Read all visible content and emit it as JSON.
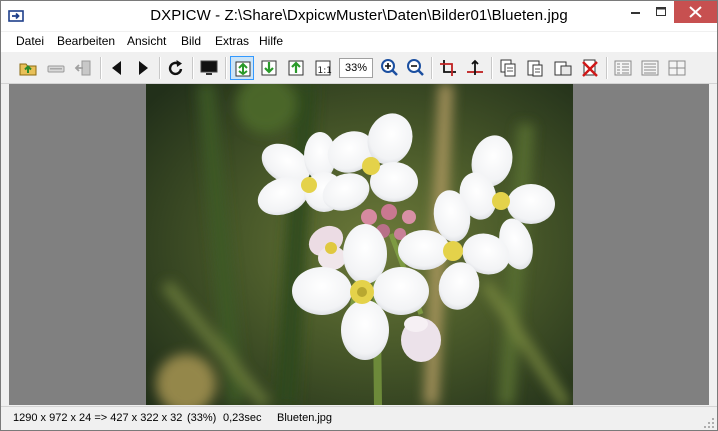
{
  "window": {
    "title": "DXPICW - Z:\\Share\\DxpicwMuster\\Daten\\Bilder01\\Blueten.jpg",
    "icons": {
      "app": "dxpicw-app-icon",
      "minimize": "minimize-icon",
      "maximize": "maximize-icon",
      "close": "close-icon"
    },
    "colors": {
      "close": "#c75050",
      "viewport": "#808080",
      "active_tool": "#cce4f7"
    }
  },
  "menu": {
    "items": [
      "Datei",
      "Bearbeiten",
      "Ansicht",
      "Bild",
      "Extras",
      "Hilfe"
    ]
  },
  "toolbar": {
    "zoom_value": "33%",
    "icons": [
      "open-folder-icon",
      "scanner-icon",
      "exit-icon",
      "previous-icon",
      "next-icon",
      "rotate-icon",
      "fullscreen-icon",
      "fit-window-icon",
      "fit-width-icon",
      "fit-height-icon",
      "original-size-icon",
      "zoom-in-icon",
      "zoom-out-icon",
      "crop-icon",
      "crop-alt-icon",
      "copy-icon",
      "paste-icon",
      "move-icon",
      "delete-icon",
      "thumbnails-icon",
      "details-icon",
      "tiles-icon"
    ]
  },
  "status": {
    "dimensions": "1290 x 972 x 24 => 427 x 322 x 32",
    "zoom": "(33%)",
    "time": "0,23sec",
    "filename": "Blueten.jpg"
  }
}
